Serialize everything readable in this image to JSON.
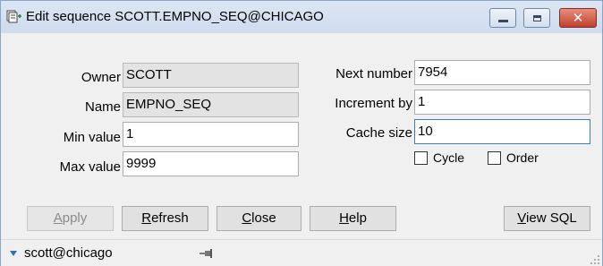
{
  "window": {
    "title": "Edit sequence SCOTT.EMPNO_SEQ@CHICAGO",
    "icon": "sequence-icon",
    "controls": {
      "minimize": "minimize-icon",
      "maximize": "maximize-icon",
      "close": "✕"
    }
  },
  "form": {
    "owner": {
      "label": "Owner",
      "value": "SCOTT"
    },
    "name": {
      "label": "Name",
      "value": "EMPNO_SEQ"
    },
    "min_value": {
      "label": "Min value",
      "value": "1"
    },
    "max_value": {
      "label": "Max value",
      "value": "9999"
    },
    "next_number": {
      "label": "Next number",
      "value": "7954"
    },
    "increment_by": {
      "label": "Increment by",
      "value": "1"
    },
    "cache_size": {
      "label": "Cache size",
      "value": "10"
    },
    "cycle": {
      "label": "Cycle",
      "checked": false
    },
    "order": {
      "label": "Order",
      "checked": false
    }
  },
  "buttons": {
    "apply": {
      "hotkey": "A",
      "rest": "pply",
      "enabled": false
    },
    "refresh": {
      "hotkey": "R",
      "rest": "efresh"
    },
    "close": {
      "hotkey": "C",
      "rest": "lose"
    },
    "help": {
      "hotkey": "H",
      "rest": "elp"
    },
    "view_sql": {
      "hotkey": "V",
      "rest": "iew SQL"
    }
  },
  "status": {
    "connection": "scott@chicago",
    "pin_icon": "pin-icon",
    "grip_icon": "resize-grip-icon"
  },
  "colors": {
    "close_button": "#c0412c",
    "titlebar": "#dce6f4",
    "focus_border": "#3c7fb1"
  }
}
